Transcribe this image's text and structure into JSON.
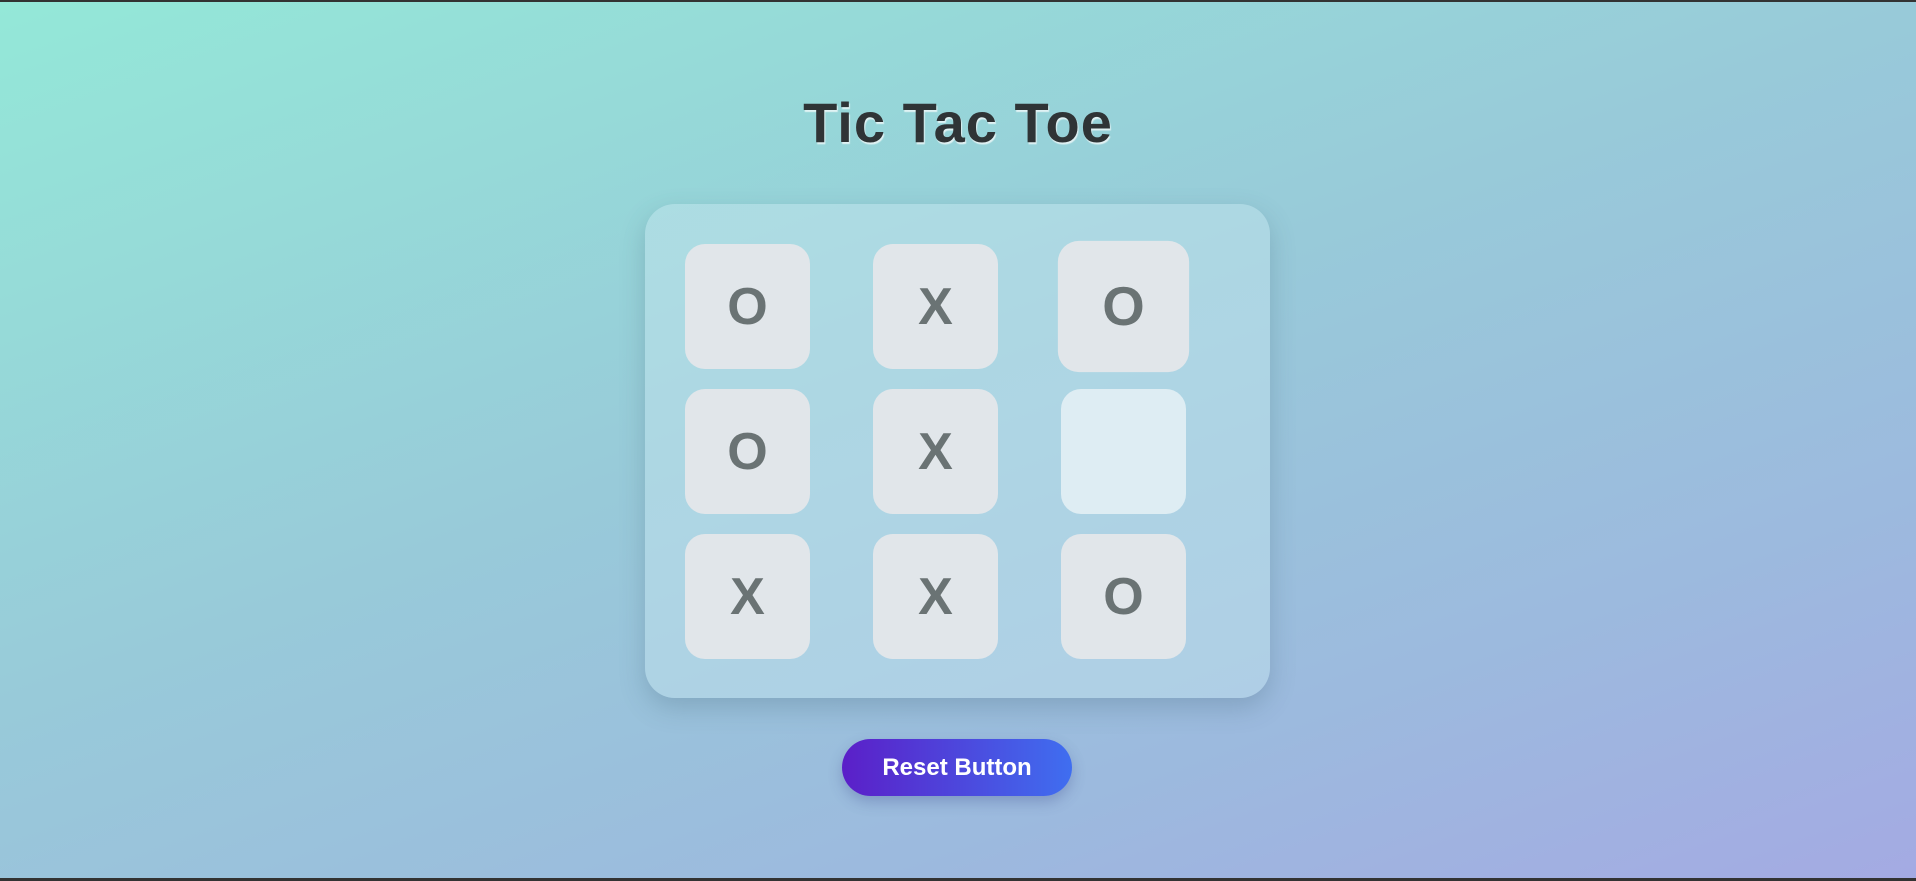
{
  "title": "Tic Tac Toe",
  "board": {
    "cells": [
      "O",
      "X",
      "O",
      "O",
      "X",
      "",
      "X",
      "X",
      "O"
    ]
  },
  "reset_label": "Reset Button",
  "colors": {
    "button_start": "#5b1fc8",
    "button_end": "#3f6ef0",
    "mark": "#6a7374"
  }
}
